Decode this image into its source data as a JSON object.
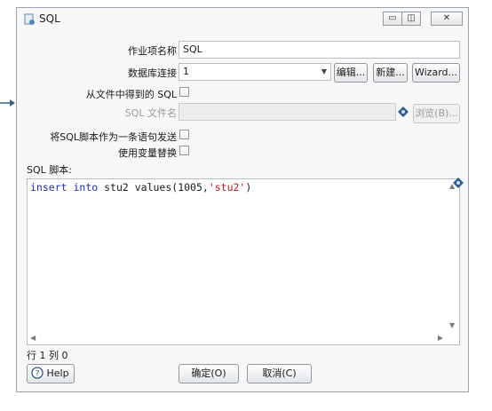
{
  "window": {
    "title": "SQL"
  },
  "form": {
    "step_name_label": "作业项名称",
    "step_name_value": "SQL",
    "connection_label": "数据库连接",
    "connection_value": "1",
    "edit_button": "编辑...",
    "new_button": "新建...",
    "wizard_button": "Wizard...",
    "sql_from_file_label": "从文件中得到的 SQL",
    "sql_filename_label": "SQL 文件名",
    "browse_button": "浏览(B)...",
    "send_as_single_label": "将SQL脚本作为一条语句发送",
    "variable_sub_label": "使用变量替换"
  },
  "editor": {
    "section_label": "SQL 脚本:",
    "code": {
      "kw1": "insert",
      "kw2": "into",
      "rest1": " stu2 values(1005,",
      "str": "'stu2'",
      "rest2": ")"
    }
  },
  "status": {
    "position": "行 1 列 0"
  },
  "footer": {
    "help_button": "Help",
    "ok_button": "确定(O)",
    "cancel_button": "取消(C)"
  },
  "icons": [
    "arrow-right-icon",
    "sql-step-icon",
    "minimize-icon",
    "restore-icon",
    "close-icon",
    "dropdown-arrow-icon",
    "variable-diamond-icon",
    "help-circle-icon"
  ],
  "colors": {
    "keyword": "#1e2fb8",
    "string": "#c01818",
    "window_border": "#9aa4b0"
  }
}
